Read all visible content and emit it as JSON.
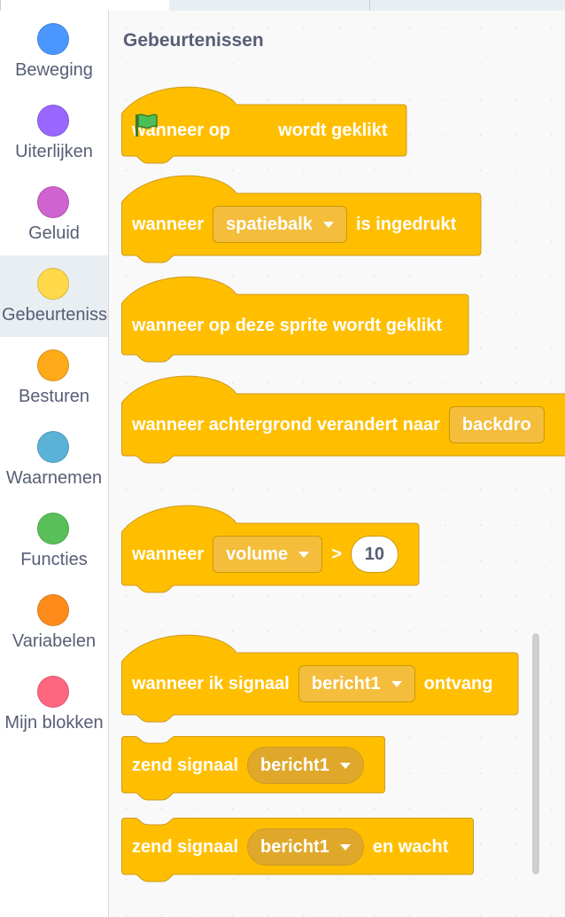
{
  "categories": [
    {
      "label": "Beweging",
      "color": "#4c97ff",
      "selected": false
    },
    {
      "label": "Uiterlijken",
      "color": "#9966ff",
      "selected": false
    },
    {
      "label": "Geluid",
      "color": "#cf63cf",
      "selected": false
    },
    {
      "label": "Gebeurtenissen",
      "color": "#ffd94a",
      "selected": true
    },
    {
      "label": "Besturen",
      "color": "#ffab19",
      "selected": false
    },
    {
      "label": "Waarnemen",
      "color": "#5cb1d6",
      "selected": false
    },
    {
      "label": "Functies",
      "color": "#59c059",
      "selected": false
    },
    {
      "label": "Variabelen",
      "color": "#ff8c1a",
      "selected": false
    },
    {
      "label": "Mijn blokken",
      "color": "#ff6680",
      "selected": false
    }
  ],
  "palette": {
    "title": "Gebeurtenissen",
    "block_color": "#ffbf00",
    "blocks": {
      "flag_clicked": {
        "prefix": "wanneer op",
        "suffix": "wordt geklikt",
        "icon": "green-flag-icon"
      },
      "key_pressed": {
        "prefix": "wanneer",
        "dropdown": "spatiebalk",
        "suffix": "is ingedrukt"
      },
      "sprite_clicked": {
        "text": "wanneer op deze sprite wordt geklikt"
      },
      "backdrop_switch": {
        "prefix": "wanneer achtergrond verandert naar",
        "dropdown": "backdro"
      },
      "greater_than": {
        "prefix": "wanneer",
        "dropdown": "volume",
        "operator": ">",
        "value": "10"
      },
      "receive": {
        "prefix": "wanneer ik signaal",
        "dropdown": "bericht1",
        "suffix": "ontvang"
      },
      "broadcast": {
        "prefix": "zend signaal",
        "dropdown": "bericht1"
      },
      "broadcast_wait": {
        "prefix": "zend signaal",
        "dropdown": "bericht1",
        "suffix": "en wacht"
      }
    }
  }
}
